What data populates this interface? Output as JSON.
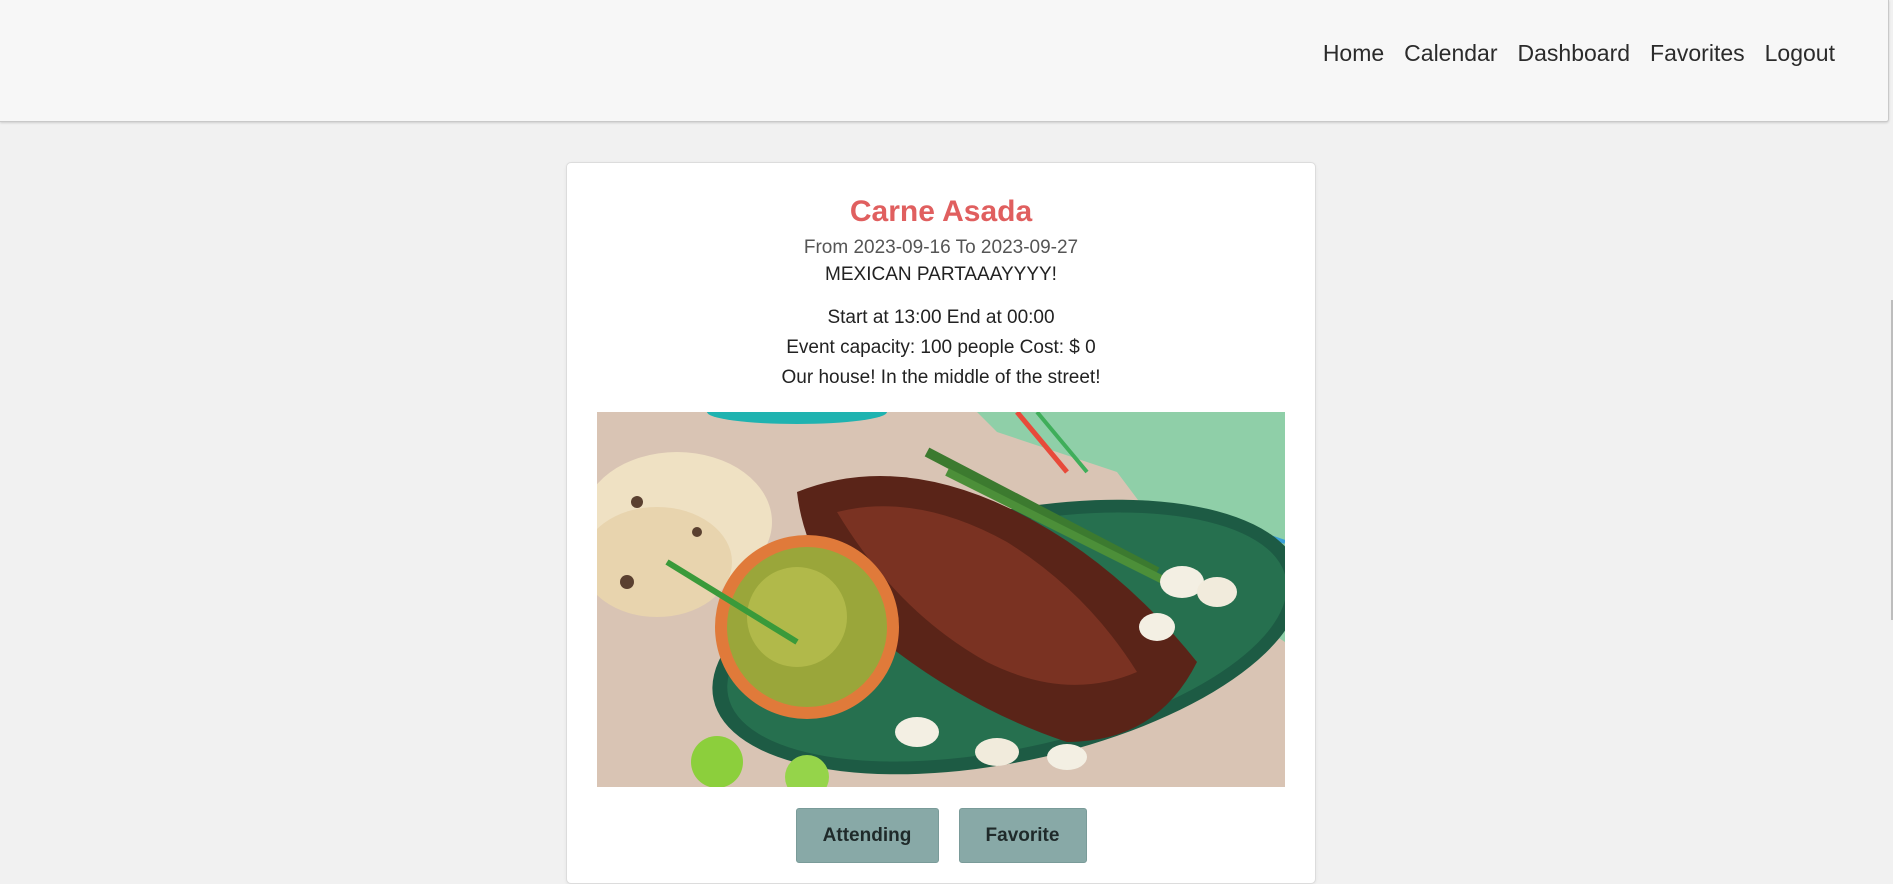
{
  "nav": {
    "items": [
      {
        "label": "Home"
      },
      {
        "label": "Calendar"
      },
      {
        "label": "Dashboard"
      },
      {
        "label": "Favorites"
      },
      {
        "label": "Logout"
      }
    ]
  },
  "event": {
    "title": "Carne Asada",
    "dates": "From 2023-09-16 To 2023-09-27",
    "description": "MEXICAN PARTAAAYYYY!",
    "times": "Start at 13:00 End at 00:00",
    "capacity": "Event capacity: 100 people Cost: $ 0",
    "location": "Our house! In the middle of the street!"
  },
  "buttons": {
    "attending_label": "Attending",
    "favorite_label": "Favorite"
  },
  "colors": {
    "title": "#e05f5f",
    "button_bg": "#88a9a7",
    "page_bg": "#f1f1f1",
    "navbar_bg": "#f7f7f7"
  }
}
